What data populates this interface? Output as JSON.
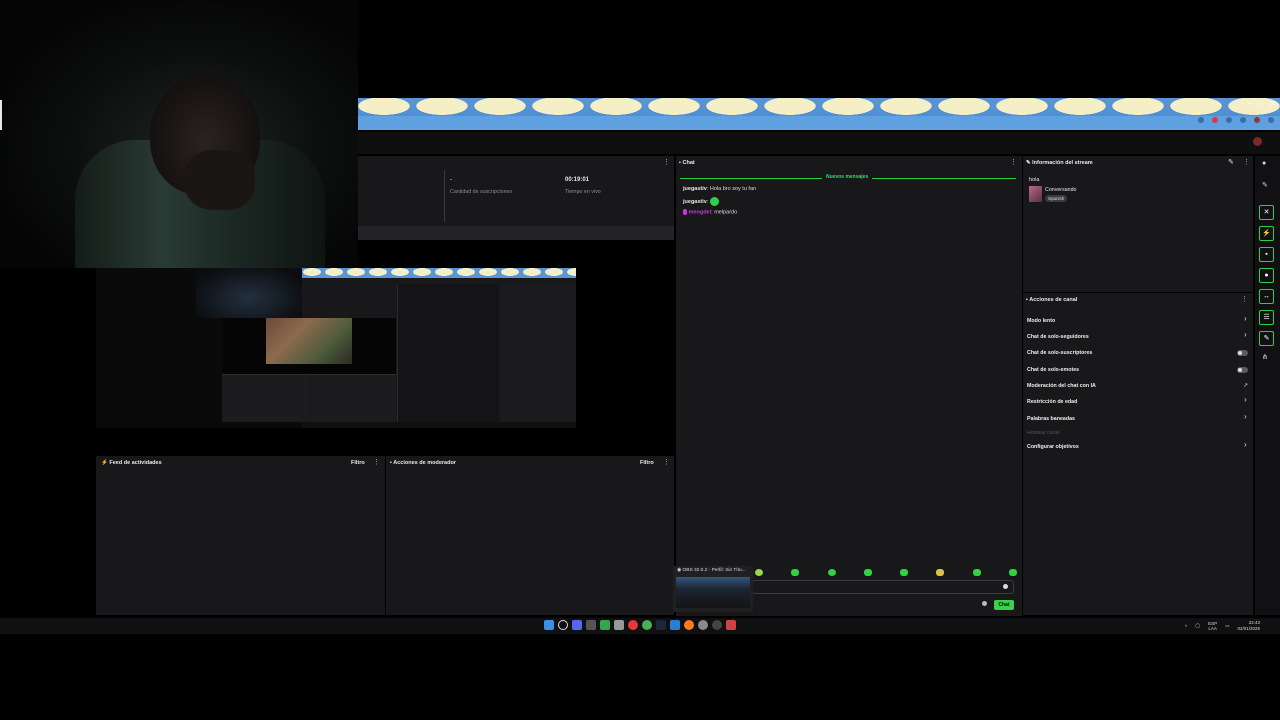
{
  "stats": {
    "dash": "-",
    "time_value": "00:19:01",
    "subs_label": "Cantidad de suscripciones",
    "live_label": "Tiempo en vivo"
  },
  "feed": {
    "title": "Feed de actividades",
    "filter": "Filtro"
  },
  "mod_actions": {
    "title": "Acciones de moderador",
    "filter": "Filtro"
  },
  "chat": {
    "title": "Chat",
    "new_messages": "Nuevos mensajes",
    "messages": [
      {
        "user": "juegastiv",
        "text": "Hola bro soy tu fan"
      },
      {
        "user": "juegastiv",
        "text": ""
      },
      {
        "user": "mengdel",
        "text": "melpardo"
      }
    ],
    "send_label": "Chat"
  },
  "obs": {
    "title": "OBS 32.0.2 - Perfil: Sin Títu..."
  },
  "stream_info": {
    "title": "Información del stream",
    "stream_title": "hola",
    "category": "Conversando",
    "language": "Spanish"
  },
  "channel_actions": {
    "title": "Acciones de canal",
    "items": [
      {
        "label": "Modo lento",
        "control": "chevron"
      },
      {
        "label": "Chat de solo-seguidores",
        "control": "chevron"
      },
      {
        "label": "Chat de solo-suscriptores",
        "control": "toggle"
      },
      {
        "label": "Chat de solo-emotes",
        "control": "toggle"
      },
      {
        "label": "Moderación del chat con IA",
        "control": "external"
      },
      {
        "label": "Restricción de edad",
        "control": "chevron"
      },
      {
        "label": "Palabras baneadas",
        "control": "chevron"
      },
      {
        "label": "Hostear canal",
        "control": "none"
      },
      {
        "label": "Configurar objetivos",
        "control": "chevron"
      }
    ]
  },
  "taskbar": {
    "lang_top": "ESP",
    "lang_bottom": "LAA",
    "time": "22:43",
    "date": "02/01/2026"
  },
  "colors": {
    "accent": "#2fcf4e",
    "panel": "#18181b",
    "sky": "#5a96d6"
  }
}
